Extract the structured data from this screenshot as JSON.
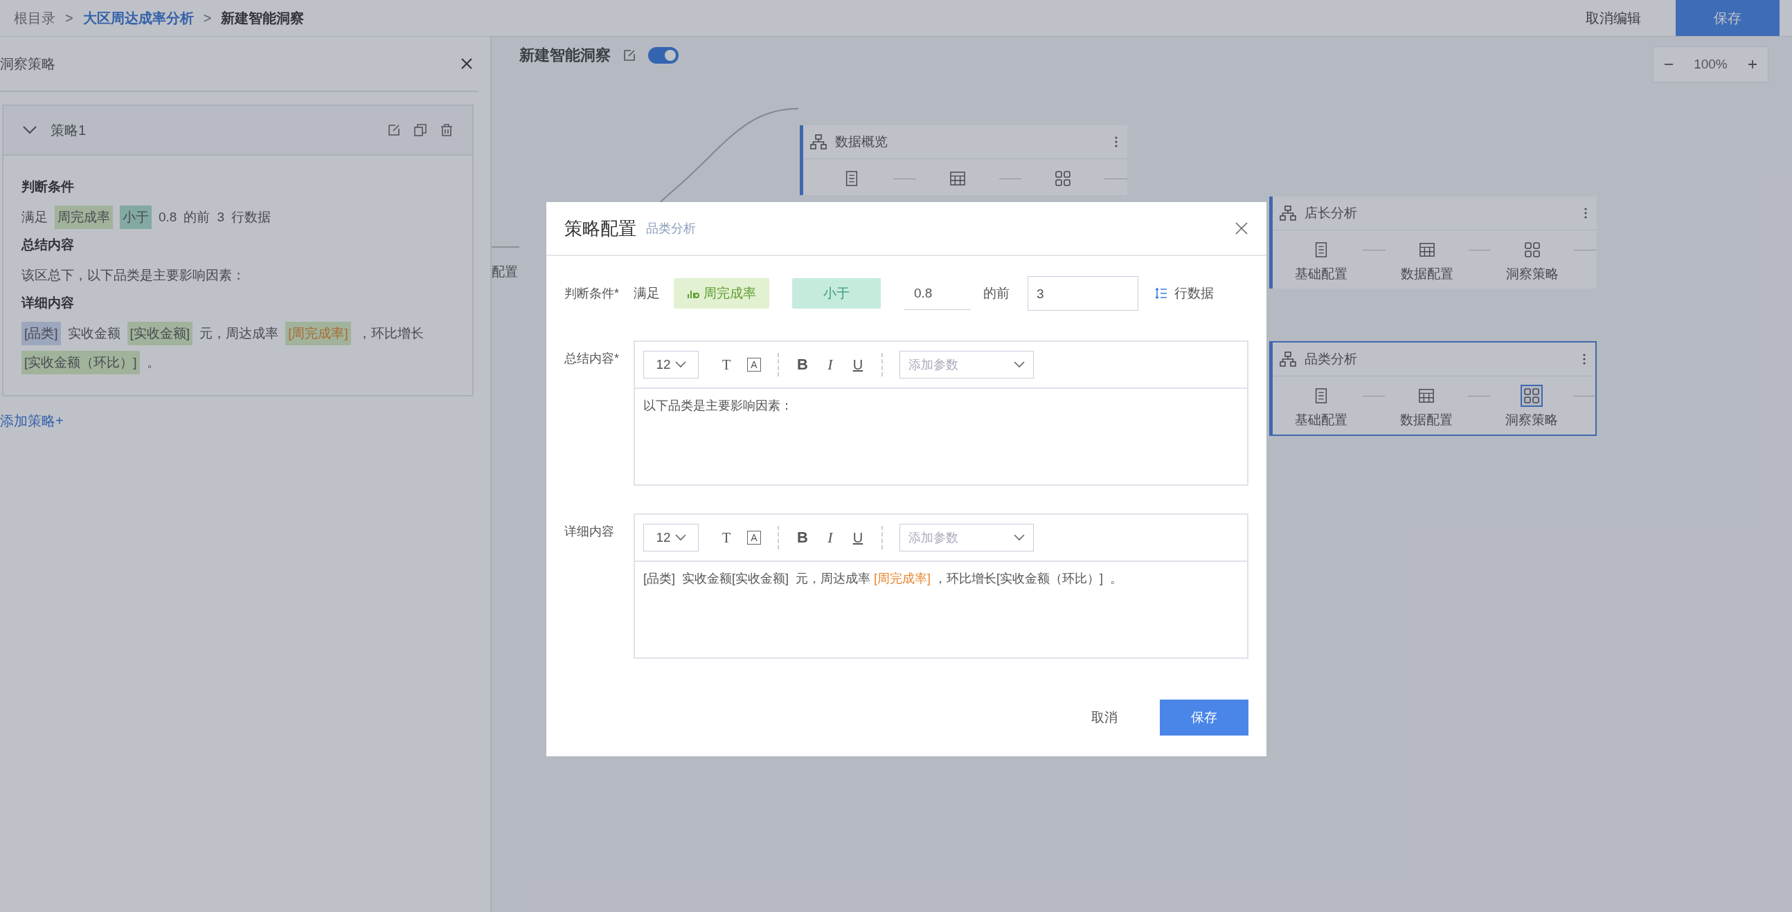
{
  "breadcrumb": [
    {
      "kind": "root",
      "label": "根目录"
    },
    {
      "kind": "sep",
      "label": ">"
    },
    {
      "kind": "link",
      "label": "大区周达成率分析"
    },
    {
      "kind": "sep",
      "label": ">"
    },
    {
      "kind": "current",
      "label": "新建智能洞察"
    }
  ],
  "header_actions": [
    {
      "kind": "text",
      "label": "取消编辑"
    },
    {
      "kind": "primary",
      "label": "保存"
    }
  ],
  "side_panel": {
    "title": "洞察策略",
    "strategies": [
      {
        "name": "策略1",
        "expanded": true,
        "sections": [
          {
            "heading": "判断条件",
            "tokens": [
              {
                "kind": "text",
                "text": "满足"
              },
              {
                "kind": "tag",
                "text": "周完成率",
                "color": "#a1b39b"
              },
              {
                "kind": "tag",
                "text": "小于",
                "color": "#83a9a3"
              },
              {
                "kind": "text",
                "text": "0.8"
              },
              {
                "kind": "text",
                "text": "的前"
              },
              {
                "kind": "text",
                "text": "3"
              },
              {
                "kind": "text",
                "text": "行数据"
              }
            ]
          },
          {
            "heading": "总结内容",
            "tokens": [
              {
                "kind": "text",
                "text": "该区总下，以下品类是主要影响因素："
              }
            ]
          },
          {
            "heading": "详细内容",
            "tokens": [
              {
                "kind": "tag",
                "text": "[品类]",
                "color": "#9ca6bc"
              },
              {
                "kind": "text",
                "text": "实收金额"
              },
              {
                "kind": "tag",
                "text": "[实收金额]",
                "color": "#a1b39b"
              },
              {
                "kind": "text",
                "text": "元，周达成率"
              },
              {
                "kind": "warn-tag",
                "text": "[周完成率]",
                "color": "#a1b39b"
              },
              {
                "kind": "text",
                "text": "，环比增长"
              },
              {
                "kind": "tag",
                "text": "[实收金额（环比）]",
                "color": "#a1b39b"
              },
              {
                "kind": "text",
                "text": "。"
              }
            ]
          }
        ]
      }
    ],
    "add_label": "添加策略+"
  },
  "canvas": {
    "title": "新建智能洞察",
    "enabled": true,
    "zoom": "100%",
    "partial_step": "配置",
    "nodes": [
      {
        "title": "数据概览",
        "selected": false,
        "steps": [
          {
            "kind": "basic",
            "selected": false
          },
          {
            "kind": "data",
            "selected": false
          },
          {
            "kind": "insight",
            "selected": false
          }
        ]
      },
      {
        "title": "店长分析",
        "selected": false,
        "steps": [
          {
            "kind": "basic",
            "label": "基础配置",
            "selected": false
          },
          {
            "kind": "data",
            "label": "数据配置",
            "selected": false
          },
          {
            "kind": "insight",
            "label": "洞察策略",
            "selected": false
          }
        ]
      },
      {
        "title": "品类分析",
        "selected": true,
        "steps": [
          {
            "kind": "basic",
            "label": "基础配置",
            "selected": false
          },
          {
            "kind": "data",
            "label": "数据配置",
            "selected": false
          },
          {
            "kind": "insight",
            "label": "洞察策略",
            "selected": true
          }
        ]
      }
    ]
  },
  "modal": {
    "title": "策略配置",
    "subtitle": "品类分析",
    "condition": {
      "label": "判断条件*",
      "prefix": "满足",
      "field": "周完成率",
      "operator": "小于",
      "value": "0.8",
      "middle": "的前",
      "count": "3",
      "suffix": "行数据"
    },
    "editors": [
      {
        "label": "总结内容*",
        "font_size": "12",
        "param_placeholder": "添加参数",
        "tools": [
          {
            "kind": "color",
            "glyph": "T"
          },
          {
            "kind": "bg",
            "glyph": "A"
          },
          {
            "kind": "bold",
            "glyph": "B"
          },
          {
            "kind": "italic",
            "glyph": "I"
          },
          {
            "kind": "underline",
            "glyph": "U"
          }
        ],
        "tokens": [
          {
            "kind": "text",
            "text": "以下品类是主要影响因素："
          }
        ]
      },
      {
        "label": "详细内容",
        "font_size": "12",
        "param_placeholder": "添加参数",
        "tools": [
          {
            "kind": "color",
            "glyph": "T"
          },
          {
            "kind": "bg",
            "glyph": "A"
          },
          {
            "kind": "bold",
            "glyph": "B"
          },
          {
            "kind": "italic",
            "glyph": "I"
          },
          {
            "kind": "underline",
            "glyph": "U"
          }
        ],
        "tokens": [
          {
            "kind": "text",
            "text": "[品类]  实收金额[实收金额]  元，周达成率 "
          },
          {
            "kind": "highlight",
            "text": "[周完成率]"
          },
          {
            "kind": "text",
            "text": " ，环比增长[实收金额（环比）]  。"
          }
        ]
      }
    ],
    "buttons": [
      {
        "kind": "cancel",
        "label": "取消"
      },
      {
        "kind": "primary",
        "label": "保存"
      }
    ]
  }
}
